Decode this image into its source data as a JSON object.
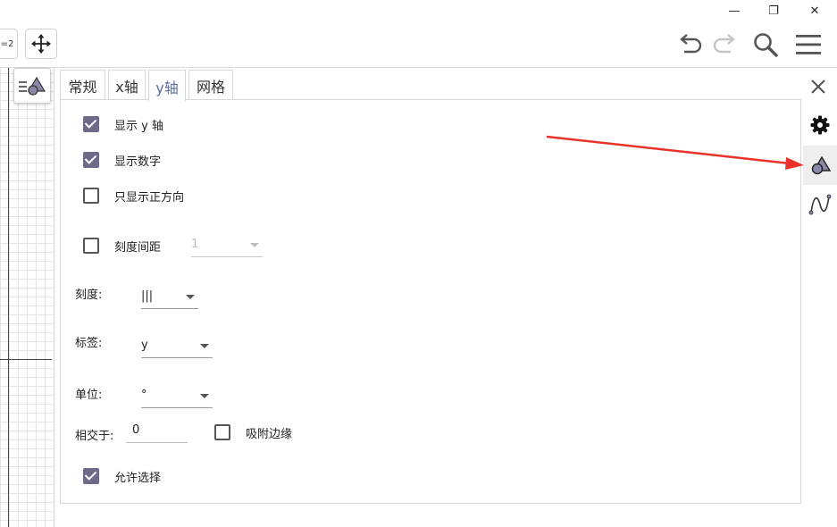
{
  "window": {
    "minimize_glyph": "—",
    "maximize_glyph": "❐",
    "close_glyph": "✕"
  },
  "toolbar": {
    "partial_tool_label": "=2",
    "move_tool": "move-icon",
    "undo": "undo-icon",
    "redo": "redo-icon",
    "search": "search-icon",
    "menu": "menu-icon"
  },
  "tabs": [
    {
      "label": "常规",
      "active": false
    },
    {
      "label": "x轴",
      "active": false
    },
    {
      "label": "y轴",
      "active": true
    },
    {
      "label": "网格",
      "active": false
    }
  ],
  "settings": {
    "show_y_axis": {
      "label": "显示 y 轴",
      "checked": true
    },
    "show_numbers": {
      "label": "显示数字",
      "checked": true
    },
    "positive_only": {
      "label": "只显示正方向",
      "checked": false
    },
    "tick_distance": {
      "label": "刻度间距",
      "checked": false,
      "value": "1"
    },
    "ticks": {
      "label": "刻度:",
      "value": "|||"
    },
    "axis_label": {
      "label": "标签:",
      "value": "y"
    },
    "unit": {
      "label": "单位:",
      "value": "°"
    },
    "cross_at": {
      "label": "相交于:",
      "value": "0"
    },
    "stick_to_edge": {
      "label": "吸附边缘",
      "checked": false
    },
    "allow_selection": {
      "label": "允许选择",
      "checked": true
    }
  },
  "sidebar": {
    "close": "close-icon",
    "items": [
      {
        "icon": "gear-icon",
        "selected": false
      },
      {
        "icon": "graphics-style-icon",
        "selected": true
      },
      {
        "icon": "function-curve-icon",
        "selected": false
      }
    ]
  },
  "colors": {
    "accent_tab": "#5a6f9e",
    "checkbox_checked": "#6e6a8c",
    "annotation_arrow": "#e8322a"
  }
}
